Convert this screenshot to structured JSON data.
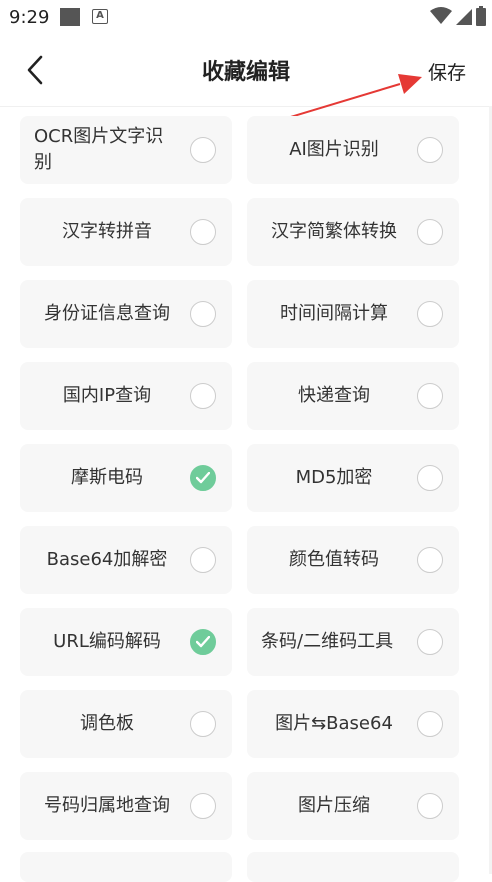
{
  "status_bar": {
    "time": "9:29"
  },
  "header": {
    "title": "收藏编辑",
    "save_label": "保存"
  },
  "accent_color": "#6fcc9a",
  "tiles": [
    {
      "label": "OCR图片文字识别",
      "checked": false
    },
    {
      "label": "AI图片识别",
      "checked": false
    },
    {
      "label": "汉字转拼音",
      "checked": false
    },
    {
      "label": "汉字简繁体转换",
      "checked": false
    },
    {
      "label": "身份证信息查询",
      "checked": false
    },
    {
      "label": "时间间隔计算",
      "checked": false
    },
    {
      "label": "国内IP查询",
      "checked": false
    },
    {
      "label": "快递查询",
      "checked": false
    },
    {
      "label": "摩斯电码",
      "checked": true
    },
    {
      "label": "MD5加密",
      "checked": false
    },
    {
      "label": "Base64加解密",
      "checked": false
    },
    {
      "label": "颜色值转码",
      "checked": false
    },
    {
      "label": "URL编码解码",
      "checked": true
    },
    {
      "label": "条码/二维码工具",
      "checked": false
    },
    {
      "label": "调色板",
      "checked": false
    },
    {
      "label": "图片⇆Base64",
      "checked": false
    },
    {
      "label": "号码归属地查询",
      "checked": false
    },
    {
      "label": "图片压缩",
      "checked": false
    }
  ]
}
